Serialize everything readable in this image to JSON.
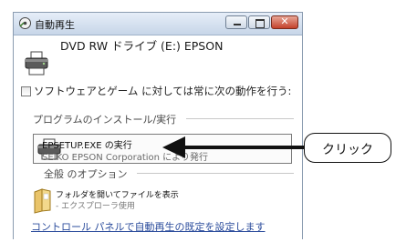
{
  "window": {
    "title": "自動再生",
    "close_glyph": "✕"
  },
  "drive": {
    "label": "DVD RW ドライブ (E:) EPSON"
  },
  "always_do": {
    "label": "ソフトウェアとゲーム に対しては常に次の動作を行う:",
    "checked": false
  },
  "sections": {
    "install": "プログラムのインストール/実行",
    "general": "全般 のオプション"
  },
  "install_option": {
    "title": "EPSETUP.EXE の実行",
    "subtitle": "SEIKO EPSON Corporation により発行"
  },
  "folder_option": {
    "title": "フォルダを開いてファイルを表示",
    "subtitle": "- エクスプローラ使用"
  },
  "control_panel_link": "コントロール パネルで自動再生の既定を設定します",
  "callout": {
    "text": "クリック"
  }
}
